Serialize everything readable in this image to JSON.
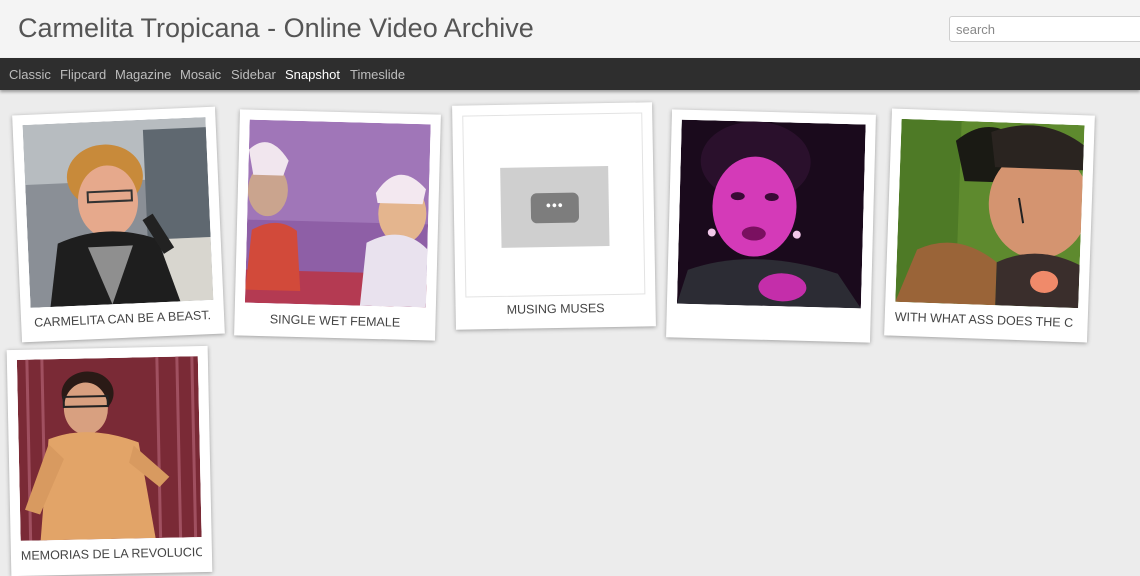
{
  "header": {
    "title": "Carmelita Tropicana - Online Video Archive",
    "search_placeholder": "search"
  },
  "nav": {
    "items": [
      "Classic",
      "Flipcard",
      "Magazine",
      "Mosaic",
      "Sidebar",
      "Snapshot",
      "Timeslide"
    ],
    "active": "Snapshot"
  },
  "videos": [
    {
      "caption": "CARMELITA CAN BE A BEAST."
    },
    {
      "caption": "SINGLE WET FEMALE"
    },
    {
      "caption": "MUSING MUSES"
    },
    {
      "caption": ""
    },
    {
      "caption": "WITH WHAT ASS DOES THE C("
    },
    {
      "caption": "MEMORIAS DE LA REVOLUCIC"
    }
  ],
  "placeholder_icon": "more-dots-icon"
}
